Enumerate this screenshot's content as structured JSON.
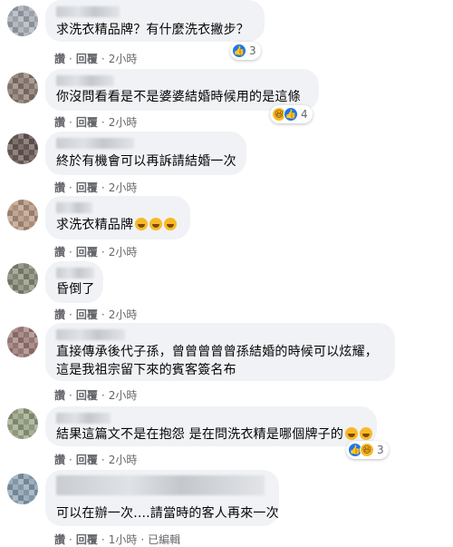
{
  "colors": {
    "bubble_bg": "#f0f2f5",
    "action_text": "#65676b",
    "like_blue": "#1877f2",
    "haha_yellow": "#f7b928"
  },
  "comments": [
    {
      "text_lines": [
        "求洗衣精品牌？有什麼洗衣撇步？"
      ],
      "actions": [
        "讚",
        "回覆"
      ],
      "time": "2小時",
      "edited": "",
      "reactions": {
        "icons": [
          "like-icon"
        ],
        "count": "3"
      }
    },
    {
      "text_lines": [
        "你沒問看看是不是婆婆結婚時候用的是這條"
      ],
      "actions": [
        "讚",
        "回覆"
      ],
      "time": "2小時",
      "edited": "",
      "reactions": {
        "icons": [
          "haha-icon",
          "like-icon"
        ],
        "count": "4"
      }
    },
    {
      "text_lines": [
        "終於有機會可以再訴請結婚一次"
      ],
      "actions": [
        "讚",
        "回覆"
      ],
      "time": "2小時",
      "edited": ""
    },
    {
      "text_lines": [
        "求洗衣精品牌"
      ],
      "trailing_emojis": [
        "rofl-emoji",
        "rofl-emoji",
        "rofl-emoji"
      ],
      "actions": [
        "讚",
        "回覆"
      ],
      "time": "2小時",
      "edited": ""
    },
    {
      "text_lines": [
        "昏倒了"
      ],
      "actions": [
        "讚",
        "回覆"
      ],
      "time": "2小時",
      "edited": ""
    },
    {
      "text_lines": [
        "直接傳承後代子孫，曾曾曾曾曾孫結婚的時候可以炫耀，",
        "這是我祖宗留下來的賓客簽名布"
      ],
      "actions": [
        "讚",
        "回覆"
      ],
      "time": "2小時",
      "edited": ""
    },
    {
      "text_lines": [
        "結果這篇文不是在抱怨 是在問洗衣精是哪個牌子的"
      ],
      "trailing_emojis": [
        "rofl-emoji",
        "rofl-emoji"
      ],
      "actions": [
        "讚",
        "回覆"
      ],
      "time": "2小時",
      "edited": "",
      "reactions": {
        "icons": [
          "like-icon",
          "haha-icon"
        ],
        "count": "3"
      }
    },
    {
      "text_lines": [
        "可以在辦一次....請當時的客人再來一次"
      ],
      "actions": [
        "讚",
        "回覆"
      ],
      "time": "1小時",
      "edited": "已編輯"
    }
  ]
}
